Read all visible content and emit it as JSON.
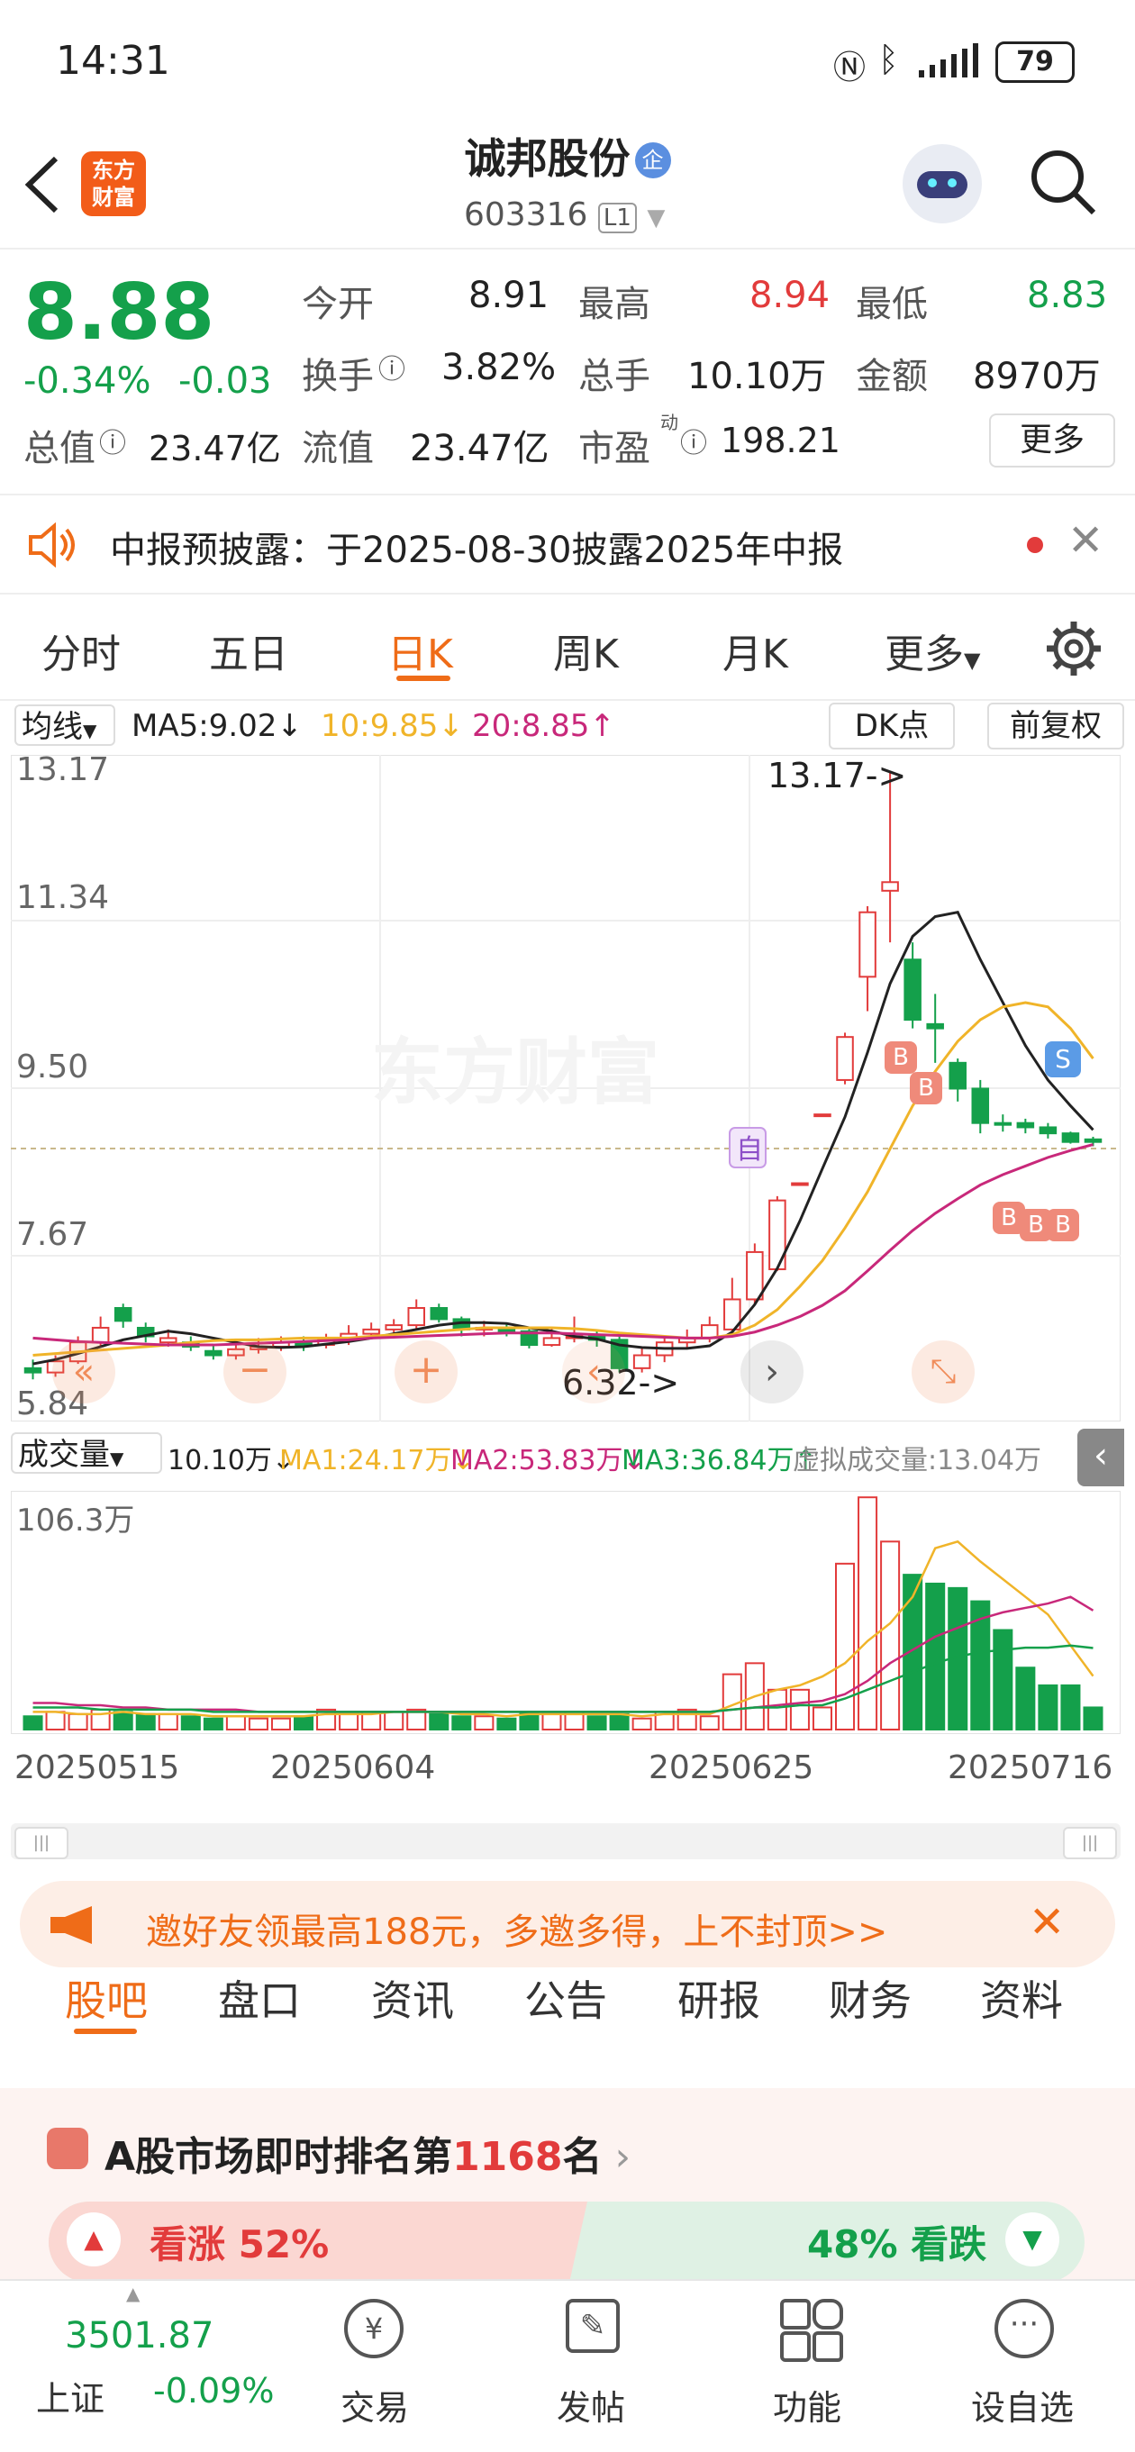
{
  "status": {
    "time": "14:31",
    "battery": "79"
  },
  "header": {
    "title": "诚邦股份",
    "badge": "企",
    "code": "603316",
    "level": "L1",
    "logo_line1": "东方",
    "logo_line2": "财富"
  },
  "quote": {
    "price": "8.88",
    "change_pct": "-0.34%",
    "change": "-0.03",
    "open_label": "今开",
    "open": "8.91",
    "high_label": "最高",
    "high": "8.94",
    "low_label": "最低",
    "low": "8.83",
    "turnover_label": "换手",
    "turnover": "3.82%",
    "volume_label": "总手",
    "volume": "10.10万",
    "amount_label": "金额",
    "amount": "8970万",
    "mcap_label": "总值",
    "mcap": "23.47亿",
    "float_label": "流值",
    "float_cap": "23.47亿",
    "pe_label": "市盈",
    "pe_sup": "动",
    "pe": "198.21",
    "more": "更多"
  },
  "notice": {
    "text": "中报预披露：于2025-08-30披露2025年中报"
  },
  "tabs": [
    "分时",
    "五日",
    "日K",
    "周K",
    "月K",
    "更多"
  ],
  "kline": {
    "ma_selector": "均线",
    "ma5": "MA5:9.02↓",
    "ma10": "10:9.85↓",
    "ma20": "20:8.85↑",
    "dk_button": "DK点",
    "adjust_button": "前复权",
    "y_labels": [
      "13.17",
      "11.34",
      "9.50",
      "7.67",
      "5.84"
    ],
    "high_annotation": "13.17->",
    "low_annotation": "6.32->",
    "watermark": "东方财富",
    "self_marker": "自",
    "sell_marker": "S",
    "buy_marker": "B",
    "colors": {
      "up": "#e23b3b",
      "down": "#14a04b",
      "ma5": "#222222",
      "ma10": "#f0b429",
      "ma20": "#c8287a"
    }
  },
  "chart_data": [
    {
      "type": "candlestick",
      "title": "",
      "ylim": [
        5.84,
        13.17
      ],
      "x": [
        "20250515",
        "20250604",
        "20250625",
        "20250716"
      ],
      "candles": [
        [
          6.25,
          6.2,
          6.35,
          6.12
        ],
        [
          6.2,
          6.33,
          6.4,
          6.15
        ],
        [
          6.33,
          6.55,
          6.62,
          6.3
        ],
        [
          6.55,
          6.72,
          6.85,
          6.5
        ],
        [
          6.95,
          6.8,
          7.0,
          6.72
        ],
        [
          6.72,
          6.62,
          6.78,
          6.55
        ],
        [
          6.55,
          6.6,
          6.7,
          6.5
        ],
        [
          6.55,
          6.5,
          6.62,
          6.45
        ],
        [
          6.45,
          6.4,
          6.52,
          6.35
        ],
        [
          6.4,
          6.47,
          6.55,
          6.35
        ],
        [
          6.47,
          6.5,
          6.6,
          6.42
        ],
        [
          6.5,
          6.55,
          6.62,
          6.45
        ],
        [
          6.55,
          6.52,
          6.62,
          6.45
        ],
        [
          6.52,
          6.58,
          6.65,
          6.48
        ],
        [
          6.58,
          6.65,
          6.75,
          6.52
        ],
        [
          6.65,
          6.7,
          6.78,
          6.6
        ],
        [
          6.7,
          6.75,
          6.82,
          6.65
        ],
        [
          6.75,
          6.95,
          7.05,
          6.7
        ],
        [
          6.95,
          6.82,
          7.0,
          6.78
        ],
        [
          6.82,
          6.7,
          6.85,
          6.62
        ],
        [
          6.7,
          6.72,
          6.8,
          6.62
        ],
        [
          6.72,
          6.68,
          6.78,
          6.62
        ],
        [
          6.68,
          6.52,
          6.72,
          6.48
        ],
        [
          6.52,
          6.6,
          6.72,
          6.5
        ],
        [
          6.6,
          6.62,
          6.85,
          6.55
        ],
        [
          6.62,
          6.58,
          6.7,
          6.5
        ],
        [
          6.58,
          6.25,
          6.62,
          6.2
        ],
        [
          6.25,
          6.4,
          6.48,
          6.2
        ],
        [
          6.4,
          6.55,
          6.62,
          6.32
        ],
        [
          6.55,
          6.6,
          6.7,
          6.48
        ],
        [
          6.6,
          6.75,
          6.85,
          6.55
        ],
        [
          6.7,
          7.05,
          7.3,
          6.65
        ],
        [
          7.05,
          7.6,
          7.7,
          6.98
        ],
        [
          7.4,
          8.2,
          8.25,
          7.38
        ],
        [
          8.4,
          8.4,
          8.4,
          8.4
        ],
        [
          9.2,
          9.2,
          9.2,
          9.2
        ],
        [
          9.6,
          10.1,
          10.15,
          9.55
        ],
        [
          10.8,
          11.55,
          11.62,
          10.4
        ],
        [
          11.8,
          11.9,
          13.17,
          11.2
        ],
        [
          11.0,
          10.3,
          11.2,
          10.2
        ],
        [
          10.25,
          10.2,
          10.6,
          9.8
        ],
        [
          9.8,
          9.5,
          9.85,
          9.35
        ],
        [
          9.5,
          9.1,
          9.6,
          8.98
        ],
        [
          9.1,
          9.08,
          9.2,
          9.0
        ],
        [
          9.1,
          9.05,
          9.15,
          8.98
        ],
        [
          9.05,
          8.98,
          9.1,
          8.92
        ],
        [
          8.98,
          8.88,
          9.0,
          8.86
        ],
        [
          8.91,
          8.88,
          8.94,
          8.83
        ]
      ],
      "series": [
        {
          "name": "MA5",
          "values": [
            6.3,
            6.35,
            6.42,
            6.5,
            6.58,
            6.63,
            6.68,
            6.65,
            6.6,
            6.55,
            6.5,
            6.49,
            6.5,
            6.53,
            6.56,
            6.6,
            6.65,
            6.7,
            6.75,
            6.78,
            6.78,
            6.77,
            6.72,
            6.68,
            6.62,
            6.59,
            6.52,
            6.49,
            6.48,
            6.48,
            6.51,
            6.67,
            6.99,
            7.41,
            7.96,
            8.57,
            9.17,
            9.92,
            10.72,
            11.27,
            11.5,
            11.55,
            11.0,
            10.5,
            10.0,
            9.6,
            9.3,
            9.02
          ]
        },
        {
          "name": "MA10",
          "values": [
            6.4,
            6.42,
            6.44,
            6.46,
            6.48,
            6.5,
            6.52,
            6.55,
            6.57,
            6.58,
            6.58,
            6.59,
            6.6,
            6.6,
            6.6,
            6.62,
            6.64,
            6.66,
            6.68,
            6.7,
            6.72,
            6.72,
            6.72,
            6.72,
            6.71,
            6.69,
            6.66,
            6.64,
            6.62,
            6.6,
            6.6,
            6.64,
            6.75,
            6.93,
            7.2,
            7.5,
            7.88,
            8.3,
            8.8,
            9.3,
            9.7,
            10.05,
            10.3,
            10.45,
            10.5,
            10.45,
            10.2,
            9.85
          ]
        },
        {
          "name": "MA20",
          "values": [
            6.6,
            6.58,
            6.56,
            6.55,
            6.54,
            6.53,
            6.52,
            6.52,
            6.52,
            6.53,
            6.54,
            6.55,
            6.56,
            6.57,
            6.58,
            6.6,
            6.61,
            6.62,
            6.63,
            6.64,
            6.65,
            6.66,
            6.66,
            6.66,
            6.65,
            6.64,
            6.63,
            6.62,
            6.61,
            6.6,
            6.6,
            6.62,
            6.67,
            6.75,
            6.85,
            6.98,
            7.15,
            7.38,
            7.62,
            7.85,
            8.05,
            8.22,
            8.38,
            8.5,
            8.6,
            8.7,
            8.78,
            8.85
          ]
        }
      ]
    },
    {
      "type": "bar",
      "title": "",
      "ymax": "106.3万",
      "selector": "成交量",
      "latest": "10.10万↓",
      "ma1": "MA1:24.17万↓",
      "ma2": "MA2:53.83万↓",
      "ma3": "MA3:36.84万↑",
      "virtual": "虚拟成交量:13.04万",
      "values": [
        6,
        8,
        7,
        9,
        8,
        7,
        7,
        6,
        5,
        6,
        5,
        5,
        6,
        9,
        7,
        8,
        8,
        9,
        7,
        6,
        6,
        5,
        8,
        7,
        8,
        6,
        7,
        5,
        8,
        9,
        6,
        25,
        30,
        18,
        18,
        10,
        75,
        105,
        85,
        70,
        66,
        64,
        58,
        45,
        28,
        20,
        20,
        10
      ],
      "series": [
        {
          "name": "MA1",
          "values": [
            8,
            8,
            7,
            7,
            8,
            7,
            7,
            7,
            6,
            6,
            6,
            6,
            6,
            7,
            7,
            7,
            8,
            8,
            8,
            7,
            7,
            6,
            7,
            7,
            7,
            7,
            7,
            6,
            7,
            7,
            7,
            11,
            15,
            18,
            20,
            24,
            30,
            40,
            48,
            60,
            82,
            85,
            76,
            68,
            60,
            52,
            38,
            24.17
          ]
        },
        {
          "name": "MA2",
          "values": [
            12,
            12,
            11,
            11,
            10,
            10,
            9,
            9,
            9,
            9,
            8,
            8,
            8,
            8,
            8,
            8,
            8,
            8,
            8,
            8,
            8,
            8,
            8,
            8,
            8,
            8,
            8,
            8,
            8,
            8,
            8,
            9,
            10,
            11,
            12,
            13,
            16,
            22,
            30,
            36,
            42,
            46,
            50,
            53,
            55,
            57,
            60,
            53.83
          ]
        },
        {
          "name": "MA3",
          "values": [
            10,
            10,
            10,
            9,
            9,
            9,
            9,
            9,
            8,
            8,
            8,
            8,
            8,
            8,
            8,
            8,
            8,
            8,
            8,
            8,
            8,
            8,
            8,
            8,
            8,
            8,
            8,
            8,
            8,
            8,
            8,
            9,
            10,
            10,
            11,
            11,
            14,
            18,
            22,
            26,
            30,
            33,
            35,
            36,
            37,
            37,
            38,
            36.84
          ]
        }
      ]
    }
  ],
  "promo": {
    "text": "邀好友领最高188元，多邀多得，上不封顶>>"
  },
  "section_tabs": [
    "股吧",
    "盘口",
    "资讯",
    "公告",
    "研报",
    "财务",
    "资料"
  ],
  "rank": {
    "prefix": "A股市场即时排名第",
    "rank": "1168",
    "suffix": "名"
  },
  "sentiment": {
    "up_label": "看涨 52%",
    "down_label": "48% 看跌",
    "up_pct": 52
  },
  "bottom": {
    "index_value": "3501.87",
    "index_name": "上证",
    "index_change": "-0.09%",
    "nav": [
      "交易",
      "发帖",
      "功能",
      "设自选"
    ]
  }
}
